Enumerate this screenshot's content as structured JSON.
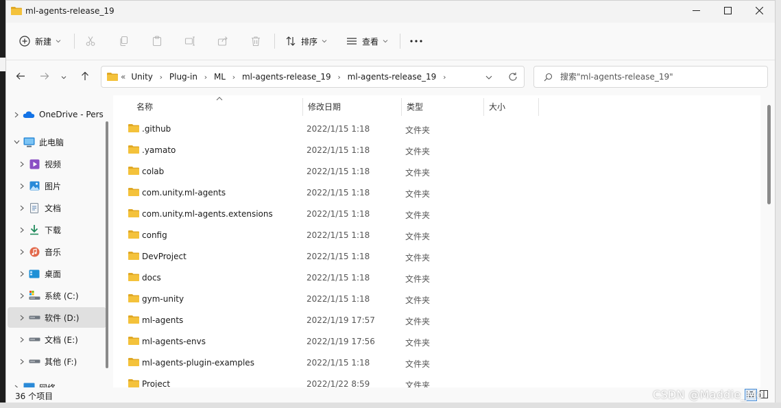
{
  "window": {
    "title": "ml-agents-release_19",
    "minimize_icon": "minimize-icon",
    "maximize_icon": "maximize-icon",
    "close_icon": "close-icon"
  },
  "toolbar": {
    "new_label": "新建",
    "sort_label": "排序",
    "view_label": "查看",
    "more_icon": "more-icon"
  },
  "address": {
    "overflow": "«",
    "crumbs": [
      "Unity",
      "Plug-in",
      "ML",
      "ml-agents-release_19",
      "ml-agents-release_19"
    ]
  },
  "search": {
    "placeholder": "搜索\"ml-agents-release_19\""
  },
  "sidebar": {
    "items": [
      {
        "label": "OneDrive - Pers",
        "icon": "cloud-icon"
      },
      {
        "label": "此电脑",
        "icon": "computer-icon"
      },
      {
        "label": "视频",
        "icon": "video-icon"
      },
      {
        "label": "图片",
        "icon": "picture-icon"
      },
      {
        "label": "文档",
        "icon": "document-icon"
      },
      {
        "label": "下载",
        "icon": "download-icon"
      },
      {
        "label": "音乐",
        "icon": "music-icon"
      },
      {
        "label": "桌面",
        "icon": "desktop-icon"
      },
      {
        "label": "系统 (C:)",
        "icon": "system-drive-icon"
      },
      {
        "label": "软件 (D:)",
        "icon": "drive-icon"
      },
      {
        "label": "文档 (E:)",
        "icon": "drive-icon"
      },
      {
        "label": "其他 (F:)",
        "icon": "drive-icon"
      },
      {
        "label": "网络",
        "icon": "network-icon"
      }
    ]
  },
  "columns": {
    "name": "名称",
    "date": "修改日期",
    "type": "类型",
    "size": "大小"
  },
  "files": [
    {
      "name": ".github",
      "date": "2022/1/15 1:18",
      "type": "文件夹"
    },
    {
      "name": ".yamato",
      "date": "2022/1/15 1:18",
      "type": "文件夹"
    },
    {
      "name": "colab",
      "date": "2022/1/15 1:18",
      "type": "文件夹"
    },
    {
      "name": "com.unity.ml-agents",
      "date": "2022/1/15 1:18",
      "type": "文件夹"
    },
    {
      "name": "com.unity.ml-agents.extensions",
      "date": "2022/1/15 1:18",
      "type": "文件夹"
    },
    {
      "name": "config",
      "date": "2022/1/15 1:18",
      "type": "文件夹"
    },
    {
      "name": "DevProject",
      "date": "2022/1/15 1:18",
      "type": "文件夹"
    },
    {
      "name": "docs",
      "date": "2022/1/15 1:18",
      "type": "文件夹"
    },
    {
      "name": "gym-unity",
      "date": "2022/1/15 1:18",
      "type": "文件夹"
    },
    {
      "name": "ml-agents",
      "date": "2022/1/19 17:57",
      "type": "文件夹"
    },
    {
      "name": "ml-agents-envs",
      "date": "2022/1/19 17:56",
      "type": "文件夹"
    },
    {
      "name": "ml-agents-plugin-examples",
      "date": "2022/1/15 1:18",
      "type": "文件夹"
    },
    {
      "name": "Project",
      "date": "2022/1/22 8:59",
      "type": "文件夹"
    }
  ],
  "status": {
    "count": "36 个项目"
  },
  "watermark": "CSDN @Maddie_Mo",
  "colors": {
    "folder": "#f4c23b",
    "folder_dark": "#e0a824",
    "selection": "#e0e0e0"
  }
}
